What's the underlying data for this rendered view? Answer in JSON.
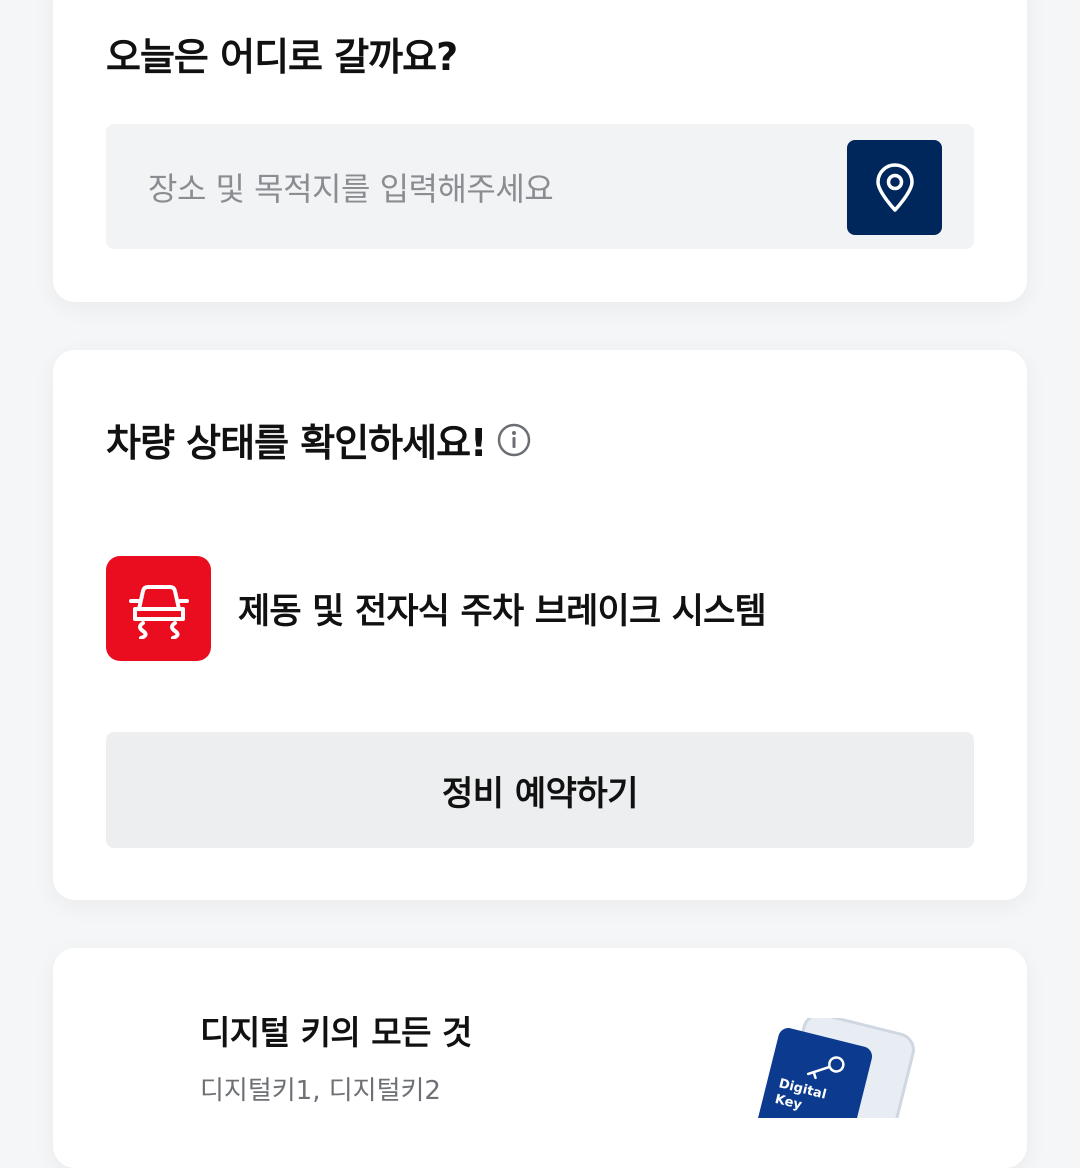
{
  "destination": {
    "title": "오늘은 어디로 갈까요?",
    "search_placeholder": "장소 및 목적지를 입력해주세요",
    "location_icon": "map-pin-icon"
  },
  "vehicle_status": {
    "title": "차량 상태를 확인하세요!",
    "info_icon": "info-icon",
    "warning": {
      "icon": "car-skid-warning-icon",
      "label": "제동 및 전자식 주차 브레이크 시스템"
    },
    "service_button_label": "정비 예약하기"
  },
  "digital_key": {
    "title": "디지털 키의 모든 것",
    "subtitle": "디지털키1, 디지털키2",
    "card_text_line1": "Digital",
    "card_text_line2": "Key"
  },
  "colors": {
    "background": "#f5f6f7",
    "card": "#ffffff",
    "primary_navy": "#00275b",
    "warning_red": "#ea0c1f",
    "input_bg": "#f2f3f5",
    "button_bg": "#edeef0"
  }
}
